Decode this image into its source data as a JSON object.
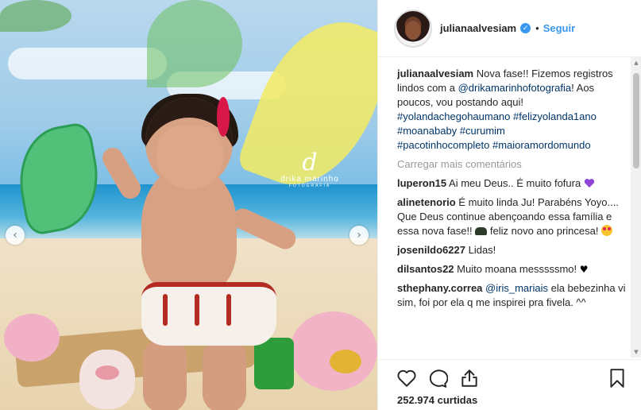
{
  "post": {
    "likes": "252.974 curtidas"
  },
  "header": {
    "username": "julianaalvesiam",
    "separator": "•",
    "follow_label": "Seguir",
    "verified_icon": "verified-badge-icon"
  },
  "photo": {
    "watermark_script": "d",
    "watermark_name": "drika marinho",
    "watermark_sub": "FOTOGRAFIA",
    "prev_icon": "chevron-left-icon",
    "next_icon": "chevron-right-icon",
    "prev_glyph": "‹",
    "next_glyph": "›"
  },
  "caption": {
    "user": "julianaalvesiam",
    "text1": " Nova fase!! Fizemos registros lindos com a ",
    "mention": "@drikamarinhofotografia",
    "text2": "! Aos poucos, vou postando aqui!",
    "hashtags": [
      "#yolandachegohaumano",
      "#felizyolanda1ano",
      "#moanababy",
      "#curumim",
      "#pacotinhocompleto",
      "#maioramordomundo"
    ]
  },
  "load_more": "Carregar mais comentários",
  "comments": [
    {
      "user": "luperon15",
      "text": " Ai meu Deus.. É muito fofura "
    },
    {
      "user": "alinetenorio",
      "text": " É muito linda Ju! Parabéns Yoyo.... Que Deus continue abençoando essa família e essa nova fase!! ",
      "text_b": " feliz novo ano princesa! "
    },
    {
      "user": "josenildo6227",
      "text": " Lidas!"
    },
    {
      "user": "dilsantos22",
      "text": " Muito moana messsssmo! ",
      "heart": "♥"
    },
    {
      "user": "sthephany.correa",
      "mention": "@iris_mariais",
      "text": " ela bebezinha vi sim, foi por ela q me inspirei pra fivela. ^^"
    }
  ],
  "scrollbar": {
    "up": "▲",
    "down": "▼"
  },
  "icons": {
    "like": "heart-outline-icon",
    "comment": "comment-bubble-icon",
    "share": "share-icon",
    "save": "bookmark-icon"
  },
  "colors": {
    "link": "#3897f0",
    "tag": "#003569",
    "muted": "#999999"
  }
}
